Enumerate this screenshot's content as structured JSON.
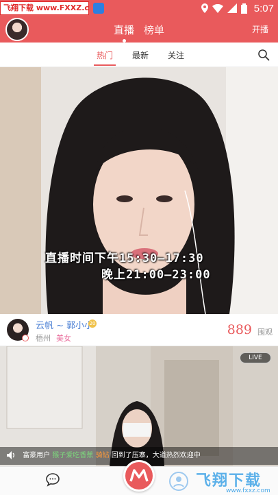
{
  "status_bar": {
    "banner_text": "飞翔下载 www.FXXZ.com",
    "time": "5:07"
  },
  "header": {
    "tabs": [
      {
        "label": "直播",
        "active": true
      },
      {
        "label": "榜单",
        "active": false
      }
    ],
    "start_live_label": "开播",
    "accent_color": "#e95a5c"
  },
  "sub_tabs": [
    {
      "label": "热门",
      "active": true
    },
    {
      "label": "最新",
      "active": false
    },
    {
      "label": "关注",
      "active": false
    }
  ],
  "feed": {
    "card1": {
      "overlay_line1": "直播时间下午15:30—17:30",
      "overlay_line2": "晚上21:00—23:00",
      "anchor_name": "云帆 ~ 郭小小",
      "level": "20",
      "city": "梧州",
      "tag": "美女",
      "viewer_count": "889",
      "viewer_label": "围观"
    },
    "card2": {
      "live_badge": "LIVE"
    }
  },
  "ticker": {
    "prefix": "富豪用户",
    "user": "猴子爱吃香蕉",
    "action": "骑钻",
    "suffix": "回到了压寨，大道热烈欢迎中"
  },
  "watermark": {
    "title": "飞翔下载",
    "url": "www.fxxz.com"
  }
}
